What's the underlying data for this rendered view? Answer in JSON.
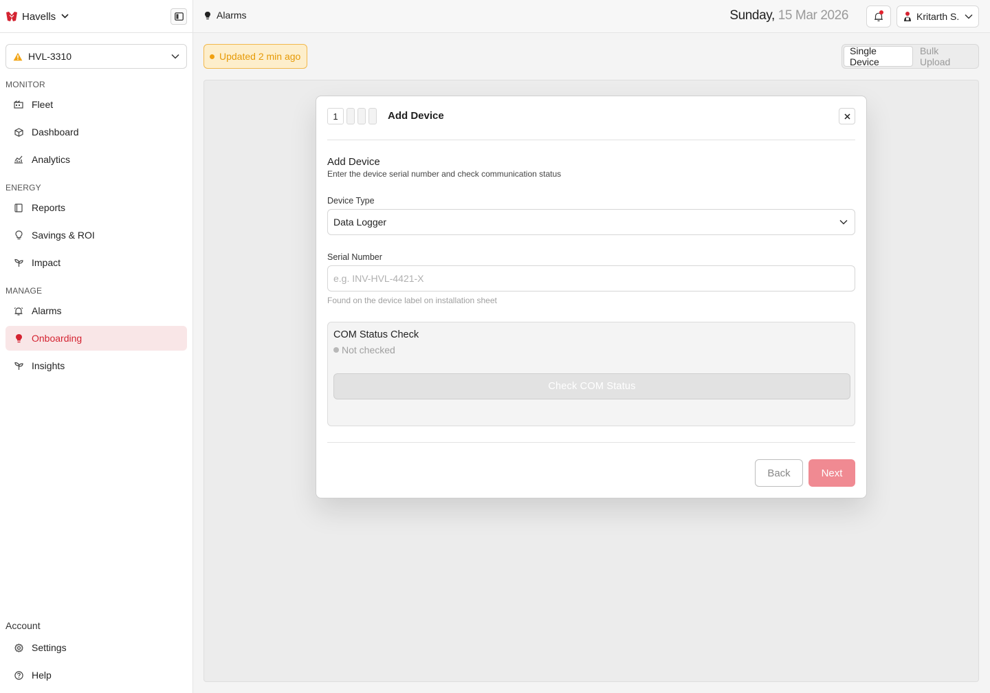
{
  "brand": {
    "name": "Havells"
  },
  "site": {
    "name": "HVL-3310"
  },
  "sidebar": {
    "sections": [
      {
        "label": "MONITOR"
      },
      {
        "label": "ENERGY"
      },
      {
        "label": "MANAGE"
      }
    ],
    "items": [
      {
        "label": "Fleet",
        "icon": "building-icon"
      },
      {
        "label": "Dashboard",
        "icon": "cube-icon"
      },
      {
        "label": "Analytics",
        "icon": "chart-icon"
      },
      {
        "label": "Reports",
        "icon": "book-icon"
      },
      {
        "label": "Savings & ROI",
        "icon": "bulb-icon"
      },
      {
        "label": "Impact",
        "icon": "sprout-icon"
      },
      {
        "label": "Alarms",
        "icon": "alarm-icon"
      },
      {
        "label": "Onboarding",
        "icon": "bulb-icon",
        "active": true
      },
      {
        "label": "Insights",
        "icon": "sprout-icon"
      }
    ],
    "account_label": "Account",
    "account_items": [
      {
        "label": "Settings",
        "icon": "gear-icon"
      },
      {
        "label": "Help",
        "icon": "help-icon"
      }
    ]
  },
  "topbar": {
    "breadcrumb": "Alarms",
    "date_day": "Sunday,",
    "date_rest": "15 Mar 2026",
    "user_name": "Kritarth S."
  },
  "status": {
    "updated": "Updated 2 min ago"
  },
  "mode": {
    "single": "Single Device",
    "bulk": "Bulk Upload"
  },
  "modal": {
    "step_current": "1",
    "title": "Add Device",
    "form_title": "Add Device",
    "form_subtitle": "Enter the device serial number and check communication status",
    "device_type_label": "Device Type",
    "device_type_value": "Data Logger",
    "serial_label": "Serial Number",
    "serial_placeholder": "e.g. INV-HVL-4421-X",
    "serial_value": "",
    "serial_hint": "Found on the device label on installation sheet",
    "com_title": "COM Status Check",
    "com_status": "Not checked",
    "com_button": "Check COM Status",
    "back": "Back",
    "next": "Next"
  },
  "colors": {
    "accent": "#d42331",
    "active_bg": "#f9e6e7",
    "warning": "#e69a06",
    "next_button": "#f08a92"
  }
}
